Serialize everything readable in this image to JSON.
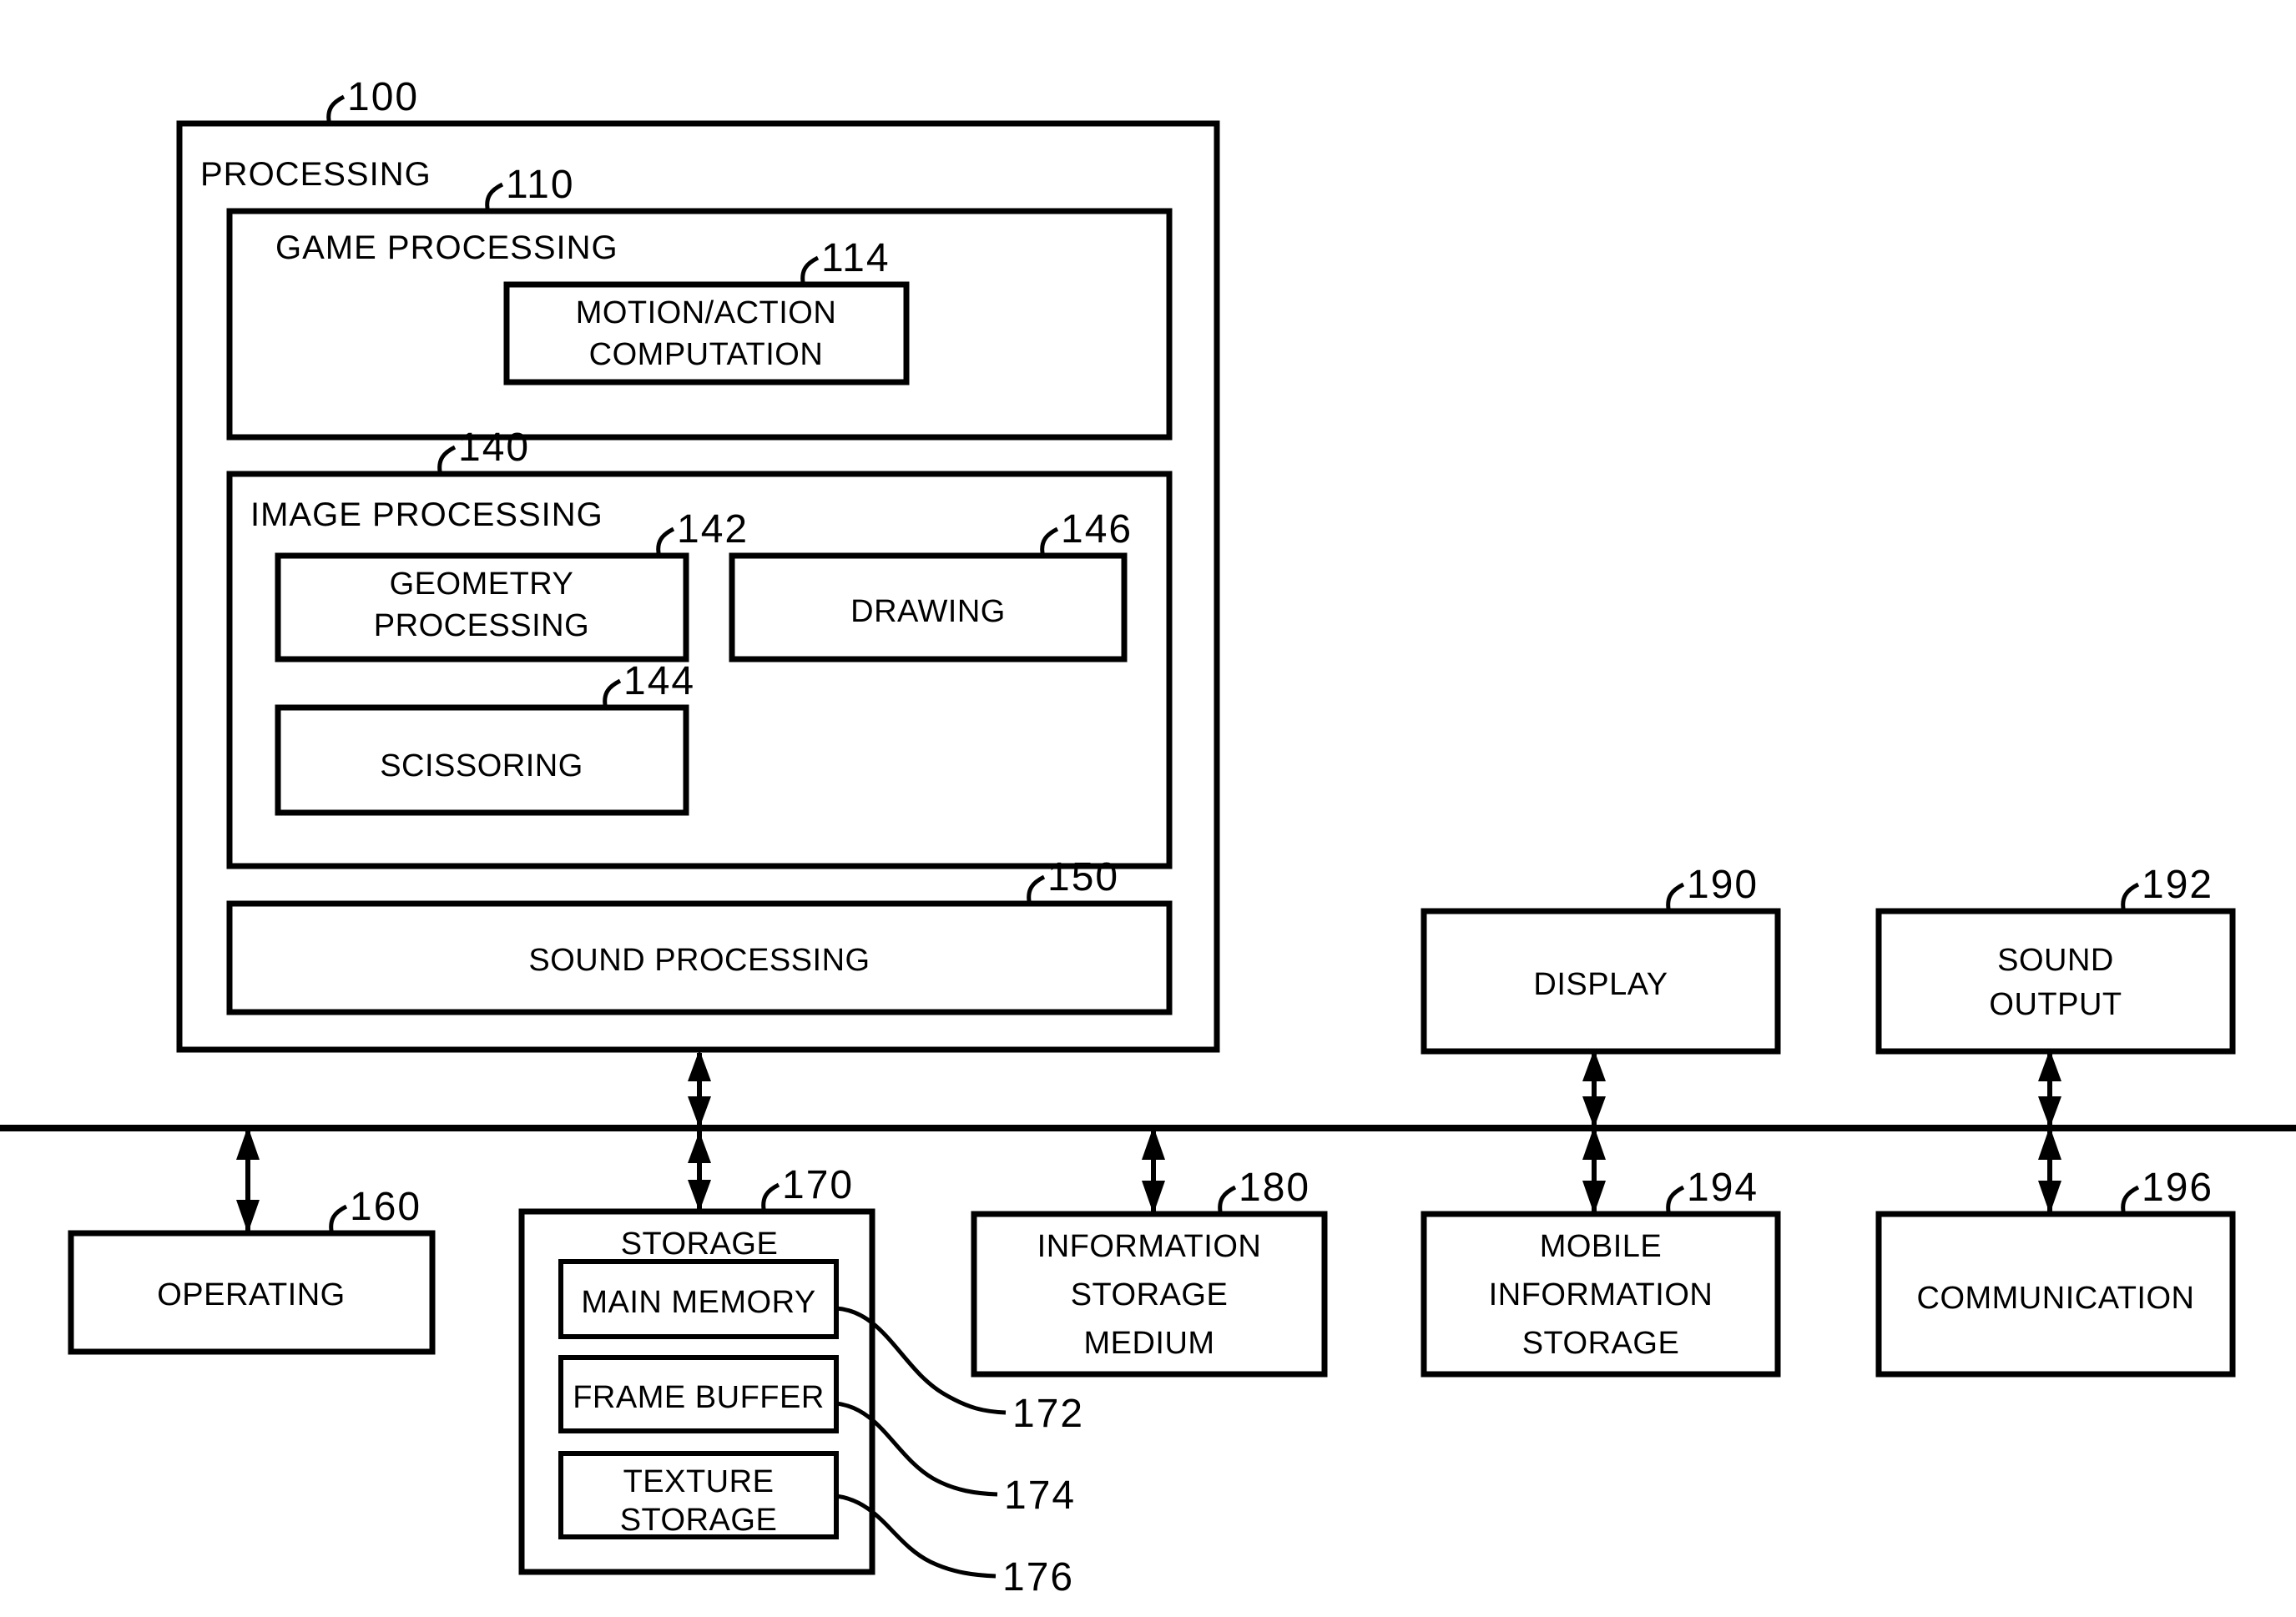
{
  "figure": {
    "type": "block-diagram",
    "title": "Game system block diagram",
    "blocks": {
      "processing": {
        "label": "PROCESSING",
        "ref": "100"
      },
      "game_processing": {
        "label": "GAME PROCESSING",
        "ref": "110"
      },
      "motion_action": {
        "label_line1": "MOTION/ACTION",
        "label_line2": "COMPUTATION",
        "ref": "114"
      },
      "image_processing": {
        "label": "IMAGE PROCESSING",
        "ref": "140"
      },
      "geometry": {
        "label_line1": "GEOMETRY",
        "label_line2": "PROCESSING",
        "ref": "142"
      },
      "scissoring": {
        "label": "SCISSORING",
        "ref": "144"
      },
      "drawing": {
        "label": "DRAWING",
        "ref": "146"
      },
      "sound_processing": {
        "label": "SOUND PROCESSING",
        "ref": "150"
      },
      "operating": {
        "label": "OPERATING",
        "ref": "160"
      },
      "storage": {
        "label": "STORAGE",
        "ref": "170"
      },
      "main_memory": {
        "label": "MAIN MEMORY",
        "ref": "172"
      },
      "frame_buffer": {
        "label": "FRAME BUFFER",
        "ref": "174"
      },
      "texture_storage": {
        "label_line1": "TEXTURE",
        "label_line2": "STORAGE",
        "ref": "176"
      },
      "info_storage": {
        "label_line1": "INFORMATION",
        "label_line2": "STORAGE",
        "label_line3": "MEDIUM",
        "ref": "180"
      },
      "display": {
        "label": "DISPLAY",
        "ref": "190"
      },
      "sound_output": {
        "label_line1": "SOUND",
        "label_line2": "OUTPUT",
        "ref": "192"
      },
      "mobile_info": {
        "label_line1": "MOBILE",
        "label_line2": "INFORMATION",
        "label_line3": "STORAGE",
        "ref": "194"
      },
      "communication": {
        "label": "COMMUNICATION",
        "ref": "196"
      }
    },
    "colors": {
      "line": "#000000",
      "fill": "#ffffff",
      "text": "#000000"
    }
  }
}
